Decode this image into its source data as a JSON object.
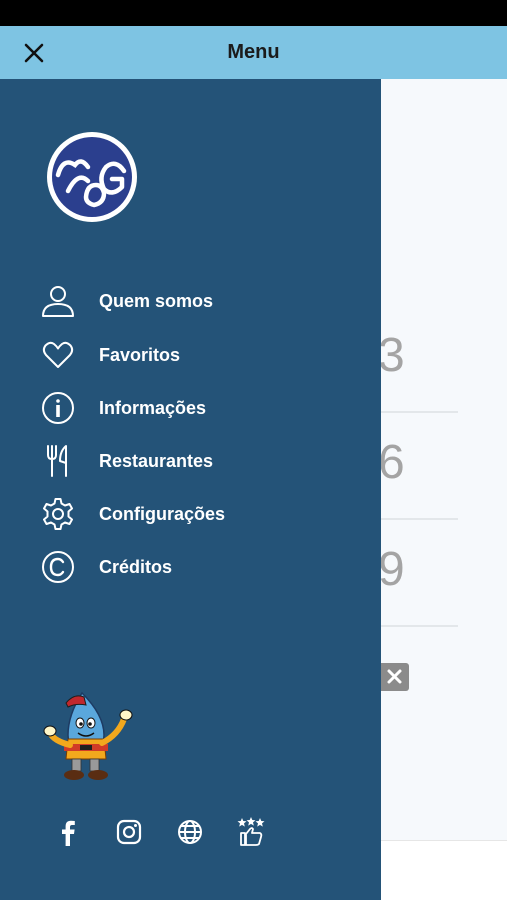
{
  "header": {
    "title": "Menu"
  },
  "menu": {
    "items": [
      {
        "label": "Quem somos",
        "icon": "person-icon"
      },
      {
        "label": "Favoritos",
        "icon": "heart-icon"
      },
      {
        "label": "Informações",
        "icon": "info-icon"
      },
      {
        "label": "Restaurantes",
        "icon": "fork-knife-icon"
      },
      {
        "label": "Configurações",
        "icon": "gear-icon"
      },
      {
        "label": "Créditos",
        "icon": "copyright-icon"
      }
    ]
  },
  "social": [
    {
      "icon": "facebook-icon"
    },
    {
      "icon": "instagram-icon"
    },
    {
      "icon": "globe-icon"
    },
    {
      "icon": "rating-icon"
    }
  ],
  "background": {
    "digits": [
      "3",
      "6",
      "9"
    ]
  },
  "colors": {
    "header": "#7ec4e3",
    "drawer": "#245378",
    "text": "#ffffff"
  }
}
